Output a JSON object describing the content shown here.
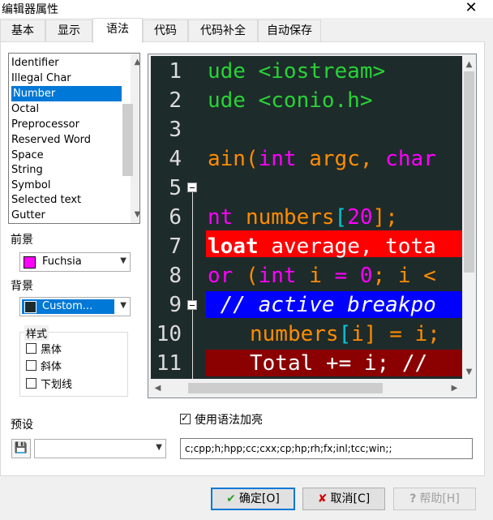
{
  "window": {
    "title": "编辑器属性",
    "close": "✕"
  },
  "tabs": [
    {
      "label": "基本"
    },
    {
      "label": "显示"
    },
    {
      "label": "语法"
    },
    {
      "label": "代码"
    },
    {
      "label": "代码补全"
    },
    {
      "label": "自动保存"
    }
  ],
  "active_tab": "语法",
  "element_list": {
    "items": [
      "Identifier",
      "Illegal Char",
      "Number",
      "Octal",
      "Preprocessor",
      "Reserved Word",
      "Space",
      "String",
      "Symbol",
      "Selected text",
      "Gutter"
    ],
    "selected": "Number"
  },
  "foreground": {
    "label": "前景",
    "value": "Fuchsia",
    "color": "#ff00ff"
  },
  "background": {
    "label": "背景",
    "value": "Custom...",
    "color": "#1e2b2b"
  },
  "style": {
    "label": "样式",
    "bold": "黑体",
    "italic": "斜体",
    "underline": "下划线",
    "bold_checked": false,
    "italic_checked": false,
    "underline_checked": false
  },
  "editor_preview": {
    "line_numbers": [
      "1",
      "2",
      "3",
      "4",
      "5",
      "6",
      "7",
      "8",
      "9",
      "10",
      "11"
    ],
    "line1": "ude <iostream>",
    "line2": "ude <conio.h>",
    "line4_a": "ain(",
    "line4_b": "int",
    "line4_c": " argc, ",
    "line4_d": "char",
    "line6_a": "nt",
    "line6_b": " numbers",
    "line6_c": "[",
    "line6_d": "20",
    "line6_e": "];",
    "line7_a": "loat",
    "line7_b": " average, tota",
    "line8_a": "or",
    "line8_b": " (",
    "line8_c": "int",
    "line8_d": " i ",
    "line8_e": "=",
    "line8_f": " 0",
    "line8_g": "; i <",
    "line9": " // active breakpo",
    "line10_a": "numbers",
    "line10_b": "[",
    "line10_c": "i",
    "line10_d": "] = i;",
    "line11": "Total += i; //",
    "colors": {
      "background": "#1e2b2b",
      "text": "#dcdcdc",
      "green": "#27d336",
      "fuchsia": "#ff00ff",
      "orange": "#ff8c00",
      "cyan": "#00c8d8",
      "error_line": "#ff0000",
      "breakpoint_line": "#0000ff",
      "active_line": "#8b0000"
    }
  },
  "use_highlight": {
    "label": "使用语法加亮",
    "checked": true
  },
  "preset": {
    "label": "预设",
    "value": ""
  },
  "extensions": "c;cpp;h;hpp;cc;cxx;cp;hp;rh;fx;inl;tcc;win;;",
  "buttons": {
    "ok": "确定[O]",
    "cancel": "取消[C]",
    "help": "帮助[H]"
  }
}
